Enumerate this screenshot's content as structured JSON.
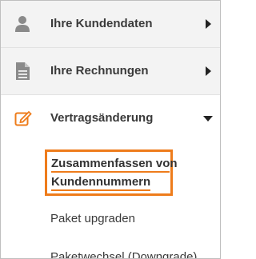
{
  "menu": {
    "items": [
      {
        "label": "Ihre Kundendaten",
        "icon": "user-icon",
        "expanded": false
      },
      {
        "label": "Ihre Rechnungen",
        "icon": "document-icon",
        "expanded": false
      },
      {
        "label": "Vertragsänderung",
        "icon": "edit-icon",
        "expanded": true
      }
    ],
    "submenu": {
      "highlighted": {
        "line1": "Zusammenfassen von",
        "line2": "Kundennummern"
      },
      "items": [
        {
          "label": "Paket upgraden"
        },
        {
          "label": "Paketwechsel (Downgrade)"
        }
      ]
    }
  },
  "colors": {
    "accent": "#ee7c1b",
    "icon_gray": "#8a8a8a",
    "item_background": "#f3f3f3"
  }
}
